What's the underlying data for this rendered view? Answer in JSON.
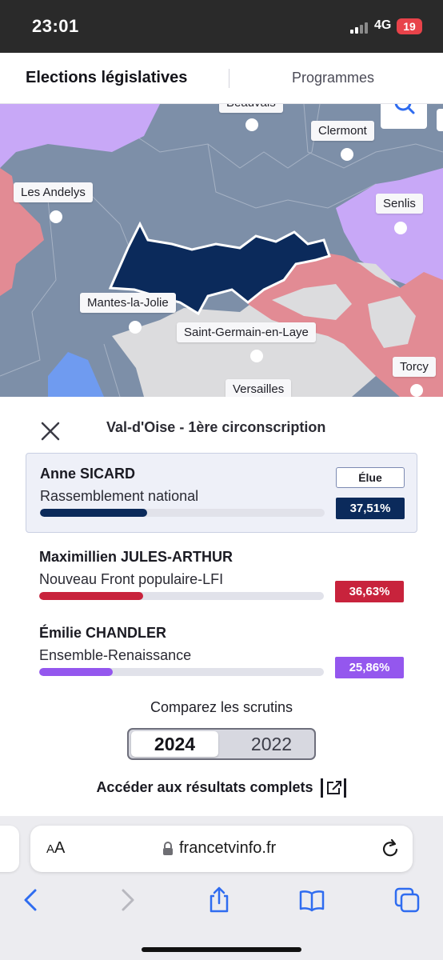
{
  "status_bar": {
    "time": "23:01",
    "network": "4G",
    "battery": "19"
  },
  "header": {
    "tab_active": "Elections législatives",
    "tab_other": "Programmes"
  },
  "map": {
    "labels": {
      "beauvais": "Beauvais",
      "clermont": "Clermont",
      "les_andelys": "Les Andelys",
      "senlis": "Senlis",
      "mantes": "Mantes-la-Jolie",
      "saint_germain": "Saint-Germain-en-Laye",
      "torcy": "Torcy",
      "versailles": "Versailles"
    },
    "colors": {
      "rn": "#7d8fa8",
      "selected": "#0b2a5b",
      "nfp": "#e28b94",
      "ensemble": "#c8a8f7",
      "other": "#d9d9dc"
    }
  },
  "panel": {
    "title": "Val-d'Oise - 1ère circonscription",
    "elected_badge": "Élue",
    "candidates": [
      {
        "name": "Anne SICARD",
        "party": "Rassemblement national",
        "percent_label": "37,51%",
        "share": 37.51,
        "color": "#0b2a5b",
        "elected": true
      },
      {
        "name": "Maximillien JULES-ARTHUR",
        "party": "Nouveau Front populaire-LFI",
        "percent_label": "36,63%",
        "share": 36.63,
        "color": "#c8233c",
        "elected": false
      },
      {
        "name": "Émilie CHANDLER",
        "party": "Ensemble-Renaissance",
        "percent_label": "25,86%",
        "share": 25.86,
        "color": "#9457ee",
        "elected": false
      }
    ],
    "compare_label": "Comparez les scrutins",
    "years": {
      "selected": "2024",
      "other": "2022"
    },
    "full_results_link": "Accéder aux résultats complets"
  },
  "browser": {
    "text_size_label": "AA",
    "url": "francetvinfo.fr"
  }
}
